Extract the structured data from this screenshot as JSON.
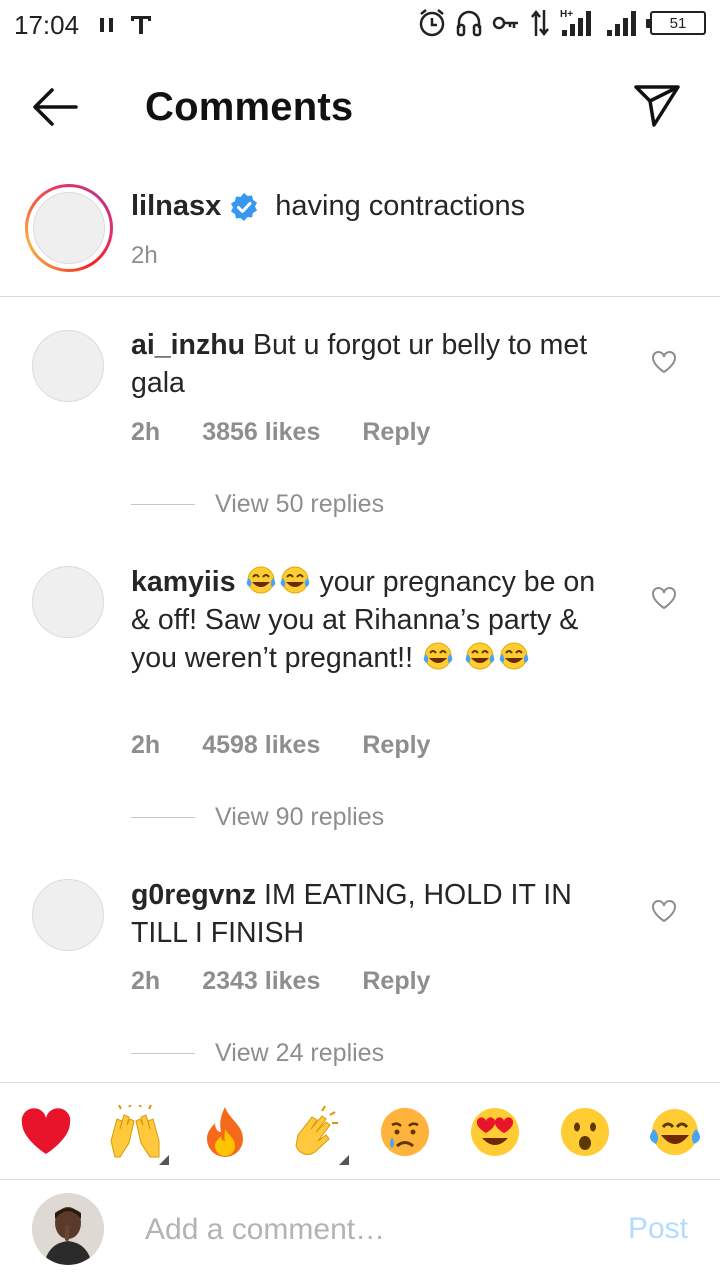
{
  "status_bar": {
    "time": "17:04",
    "left_icons": [
      "pause-icon",
      "t-icon"
    ],
    "right_icons": [
      "alarm-icon",
      "headphones-icon",
      "key-icon",
      "data-arrows-icon",
      "signal-hplus-icon",
      "signal-icon"
    ],
    "network": "H+",
    "battery": "51"
  },
  "header": {
    "title": "Comments"
  },
  "caption": {
    "username": "lilnasx",
    "text": "having contractions",
    "time": "2h"
  },
  "comments": [
    {
      "username": "ai_inzhu",
      "text": "But u forgot ur belly to met gala",
      "time": "2h",
      "likes": "3856 likes",
      "reply": "Reply",
      "view_replies": "View 50 replies"
    },
    {
      "username": "kamyiis",
      "text_part1": "your pregnancy be on & off! Saw you at Rihanna’s party & you weren’t pregnant!!",
      "emojis": "😂😂 … 😂 😂😂",
      "time": "2h",
      "likes": "4598 likes",
      "reply": "Reply",
      "view_replies": "View 90 replies"
    },
    {
      "username": "g0regvnz",
      "text": "IM EATING, HOLD IT IN TILL I FINISH",
      "time": "2h",
      "likes": "2343 likes",
      "reply": "Reply",
      "view_replies": "View 24 replies"
    }
  ],
  "emoji_bar": [
    "red-heart",
    "raising-hands",
    "fire",
    "clapping-hands",
    "crying-face",
    "heart-eyes-face",
    "astonished-face",
    "tears-of-joy-face"
  ],
  "add_comment": {
    "placeholder": "Add a comment…",
    "post_label": "Post"
  },
  "colors": {
    "link_blue": "#b3dbff",
    "verified_blue": "#3897f0",
    "secondary_text": "#8e8e8e"
  }
}
